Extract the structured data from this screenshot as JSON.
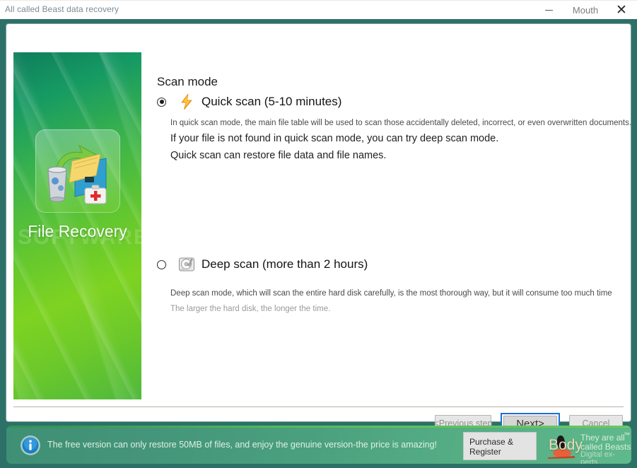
{
  "titlebar": {
    "title": "All called Beast data recovery",
    "minimize_label": "minimize",
    "middle_label": "Mouth",
    "close_label": "✕"
  },
  "sidebar": {
    "product_title": "File Recovery",
    "watermark": "SOFTWARE",
    "icon_name": "file-recovery-illustration"
  },
  "main": {
    "page_title": "Scan mode",
    "options": [
      {
        "id": "quick-scan",
        "label": "Quick scan (5-10 minutes)",
        "icon": "lightning-bolt-icon",
        "selected": true,
        "lines": [
          "In quick scan mode, the main file table will be used to scan those accidentally deleted, incorrect, or even overwritten documents.",
          "If your file is not found in quick scan mode, you can try deep scan mode.",
          "Quick scan can restore file data and file names."
        ]
      },
      {
        "id": "deep-scan",
        "label": "Deep scan (more than 2 hours)",
        "icon": "hard-disk-icon",
        "selected": false,
        "lines": [
          "Deep scan mode, which will scan the entire hard disk carefully, is the most thorough way, but it will consume too much time",
          "The larger the hard disk, the longer the time."
        ]
      }
    ]
  },
  "footer": {
    "previous_label": "<Previous step",
    "next_label": "Next>",
    "cancel_label": "Cancel"
  },
  "banner": {
    "icon": "info-icon",
    "message": "The free version can only restore 50MB of files, and enjoy the genuine version-the price is amazing!",
    "purchase_line1": "Purchase &",
    "purchase_line2": "Register",
    "brand_word": "Body",
    "brand_line1": "They are all",
    "brand_line2": "called Beasts",
    "brand_line3": "Digital ex-perts",
    "brand_tm": "™"
  },
  "colors": {
    "frame_teal": "#2d7068",
    "accent_green": "#7ed321",
    "focus_blue": "#1e6fd9",
    "bolt_orange": "#f5a623"
  }
}
